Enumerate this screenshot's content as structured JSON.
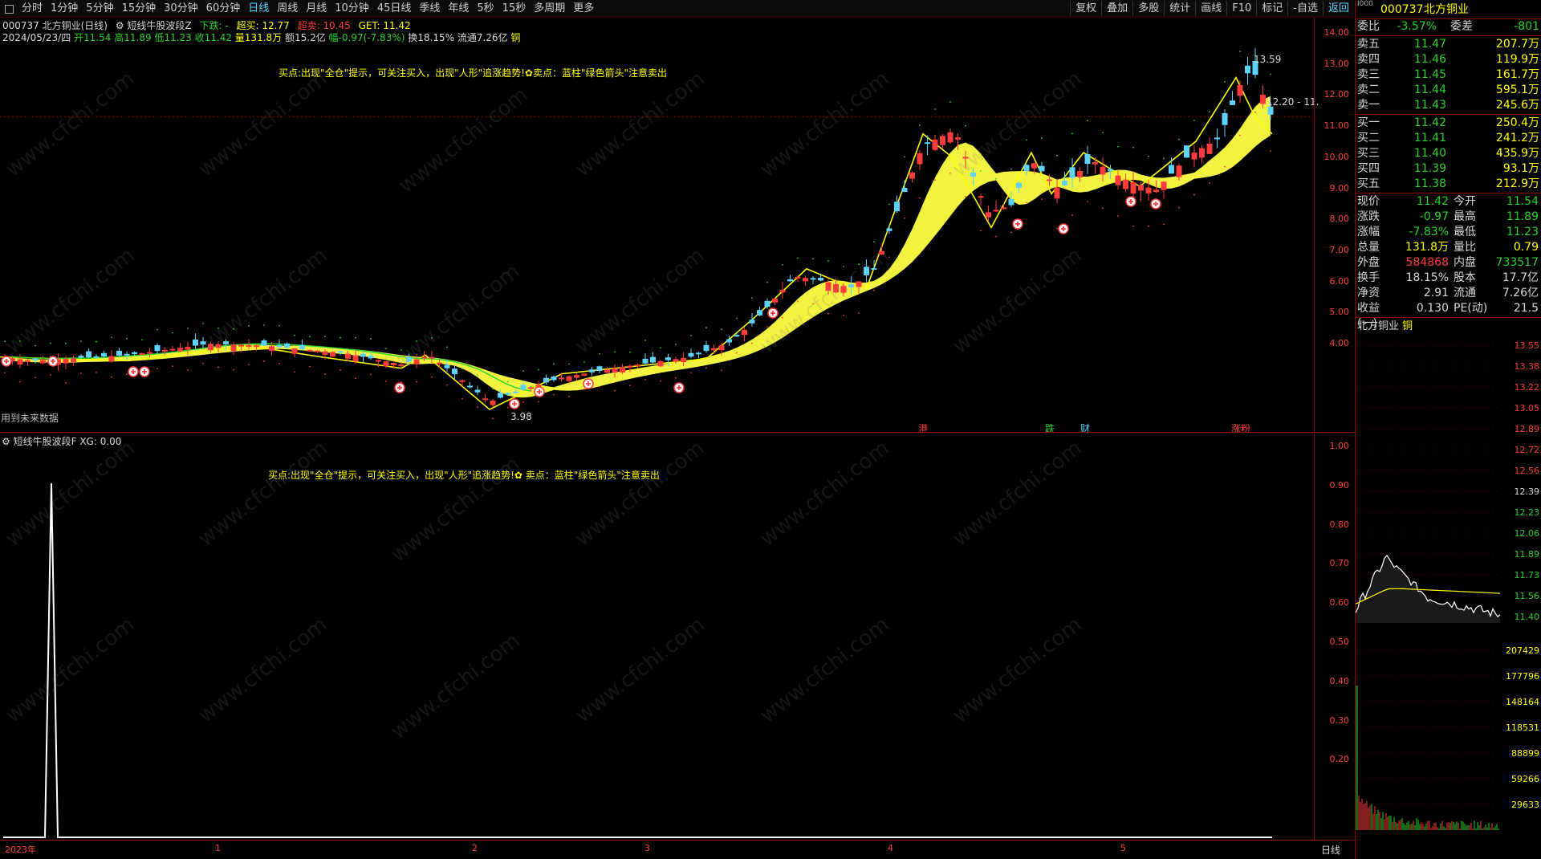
{
  "toolbar": {
    "periods": [
      "分时",
      "1分钟",
      "5分钟",
      "15分钟",
      "30分钟",
      "60分钟",
      "日线",
      "周线",
      "月线",
      "10分钟",
      "45日线",
      "季线",
      "年线",
      "5秒",
      "15秒",
      "多周期",
      "更多"
    ],
    "active_period": "日线",
    "right_buttons": [
      "复权",
      "叠加",
      "多股",
      "统计",
      "画线",
      "F10",
      "标记",
      "-自选",
      "返回"
    ],
    "active_right": "返回"
  },
  "header": {
    "code_name": "000737 北方铜业(日线)",
    "indicator_name": "短线牛股波段Z",
    "fall_label": "下跌: -",
    "buy_label": "超买: 12.77",
    "sell_label": "超卖: 10.45",
    "get_label": "GET: 11.42",
    "date": "2024/05/23/四",
    "open": "开11.54",
    "high": "高11.89",
    "low": "低11.23",
    "close": "收11.42",
    "volume": "量131.8万",
    "amount": "额15.2亿",
    "change": "幅-0.97(-7.83%)",
    "turnover": "换18.15%",
    "float_cap": "流通7.26亿",
    "sector": "铜"
  },
  "main_chart": {
    "note": "买点:出现\"全仓\"提示，可关注买入，出现\"人形\"追涨趋势!✿卖点：蓝柱\"绿色箭头\"注意卖出",
    "future_data_label": "用到未来数据",
    "high_mark": "13.59",
    "low_mark": "3.98",
    "right_price_mark": "12.20 - 11.",
    "events": [
      "港",
      "跌",
      "财",
      "涨粉"
    ],
    "yticks": [
      "14.00",
      "13.00",
      "12.00",
      "11.00",
      "10.00",
      "9.00",
      "8.00",
      "7.00",
      "6.00",
      "5.00",
      "4.00"
    ]
  },
  "sub_chart": {
    "title": "短线牛股波段F",
    "xg_value": "XG: 0.00",
    "note": "买点:出现\"全仓\"提示，可关注买入，出现\"人形\"追涨趋势!✿  卖点：蓝柱\"绿色箭头\"注意卖出",
    "yticks": [
      "1.00",
      "0.90",
      "0.80",
      "0.70",
      "0.60",
      "0.50",
      "0.40",
      "0.30",
      "0.20"
    ]
  },
  "xaxis": {
    "labels": [
      "2023年",
      "1",
      "2",
      "3",
      "4",
      "5"
    ],
    "period_label": "日线"
  },
  "quote": {
    "code": "000737",
    "name": "北方铜业",
    "weibi_label": "委比",
    "weibi": "-3.57%",
    "weicha_label": "委差",
    "weicha": "-801",
    "asks": [
      {
        "label": "卖五",
        "price": "11.47",
        "vol": "207.7万"
      },
      {
        "label": "卖四",
        "price": "11.46",
        "vol": "119.9万"
      },
      {
        "label": "卖三",
        "price": "11.45",
        "vol": "161.7万"
      },
      {
        "label": "卖二",
        "price": "11.44",
        "vol": "595.1万"
      },
      {
        "label": "卖一",
        "price": "11.43",
        "vol": "245.6万"
      }
    ],
    "bids": [
      {
        "label": "买一",
        "price": "11.42",
        "vol": "250.4万"
      },
      {
        "label": "买二",
        "price": "11.41",
        "vol": "241.2万"
      },
      {
        "label": "买三",
        "price": "11.40",
        "vol": "435.9万"
      },
      {
        "label": "买四",
        "price": "11.39",
        "vol": "93.1万"
      },
      {
        "label": "买五",
        "price": "11.38",
        "vol": "212.9万"
      }
    ],
    "stats": [
      [
        "现价",
        "11.42",
        "今开",
        "11.54"
      ],
      [
        "涨跌",
        "-0.97",
        "最高",
        "11.89"
      ],
      [
        "涨幅",
        "-7.83%",
        "最低",
        "11.23"
      ],
      [
        "总量",
        "131.8万",
        "量比",
        "0.79"
      ],
      [
        "外盘",
        "584868",
        "内盘",
        "733517"
      ],
      [
        "换手",
        "18.15%",
        "股本",
        "17.7亿"
      ],
      [
        "净资",
        "2.91",
        "流通",
        "7.26亿"
      ],
      [
        "收益(一)",
        "0.130",
        "PE(动)",
        "21.5"
      ]
    ],
    "mini_title": "北方铜业",
    "mini_sector": "铜",
    "mini_yticks": [
      "13.55",
      "13.38",
      "13.22",
      "13.05",
      "12.89",
      "12.72",
      "12.56",
      "12.39",
      "12.23",
      "12.06",
      "11.89",
      "11.73",
      "11.56",
      "11.40"
    ],
    "mini_vol_ticks": [
      "207429",
      "177796",
      "148164",
      "118531",
      "88899",
      "59266",
      "29633"
    ]
  },
  "colors": {
    "up": "#ff3b3b",
    "down": "#5fd3ff",
    "ma": "#ffff00",
    "grid": "#8b0000"
  }
}
